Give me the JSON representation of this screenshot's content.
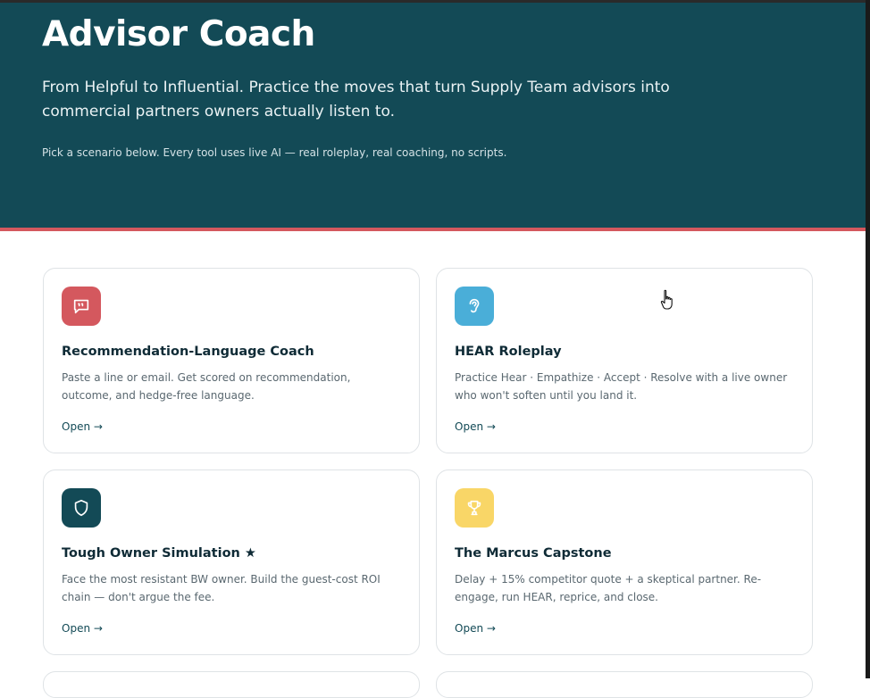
{
  "hero": {
    "title": "Advisor Coach",
    "subtitle": "From Helpful to Influential. Practice the moves that turn Supply Team advisors into commercial partners owners actually listen to.",
    "note": "Pick a scenario below. Every tool uses live AI — real roleplay, real coaching, no scripts."
  },
  "colors": {
    "hero_bg": "#134a56",
    "accent": "#d4585e",
    "card_border": "#dfe3e6",
    "text_primary": "#0f2b36",
    "text_muted": "#5a6870"
  },
  "cards": [
    {
      "icon": "speech-bubble-icon",
      "icon_color": "#d4585e",
      "title": "Recommendation-Language Coach",
      "description": "Paste a line or email. Get scored on recommendation, outcome, and hedge-free language.",
      "link_label": "Open →"
    },
    {
      "icon": "ear-icon",
      "icon_color": "#4aaed8",
      "title": "HEAR Roleplay",
      "description": "Practice Hear · Empathize · Accept · Resolve with a live owner who won't soften until you land it.",
      "link_label": "Open →"
    },
    {
      "icon": "shield-icon",
      "icon_color": "#134a56",
      "title": "Tough Owner Simulation ★",
      "description": "Face the most resistant BW owner. Build the guest-cost ROI chain — don't argue the fee.",
      "link_label": "Open →"
    },
    {
      "icon": "trophy-icon",
      "icon_color": "#f9d667",
      "title": "The Marcus Capstone",
      "description": "Delay + 15% competitor quote + a skeptical partner. Re-engage, run HEAR, reprice, and close.",
      "link_label": "Open →"
    }
  ]
}
